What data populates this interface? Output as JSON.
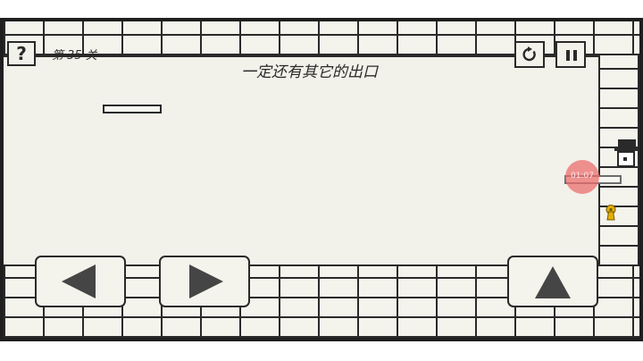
{
  "level": {
    "label": "第 35 关"
  },
  "hint": {
    "text": "一定还有其它的出口"
  },
  "help": {
    "label": "?"
  },
  "touch_indicator": {
    "text": "01:07"
  },
  "icons": {
    "help": "question-mark-icon",
    "restart": "restart-icon",
    "pause": "pause-icon",
    "left": "left-arrow-icon",
    "right": "right-arrow-icon",
    "jump": "up-arrow-icon",
    "keyhole": "keyhole-icon"
  },
  "colors": {
    "ink": "#2a2a2a",
    "background": "#f2f1ea",
    "frame": "#1f1f1f",
    "keyhole": "#e2b100",
    "touch": "#eb6e6e"
  }
}
